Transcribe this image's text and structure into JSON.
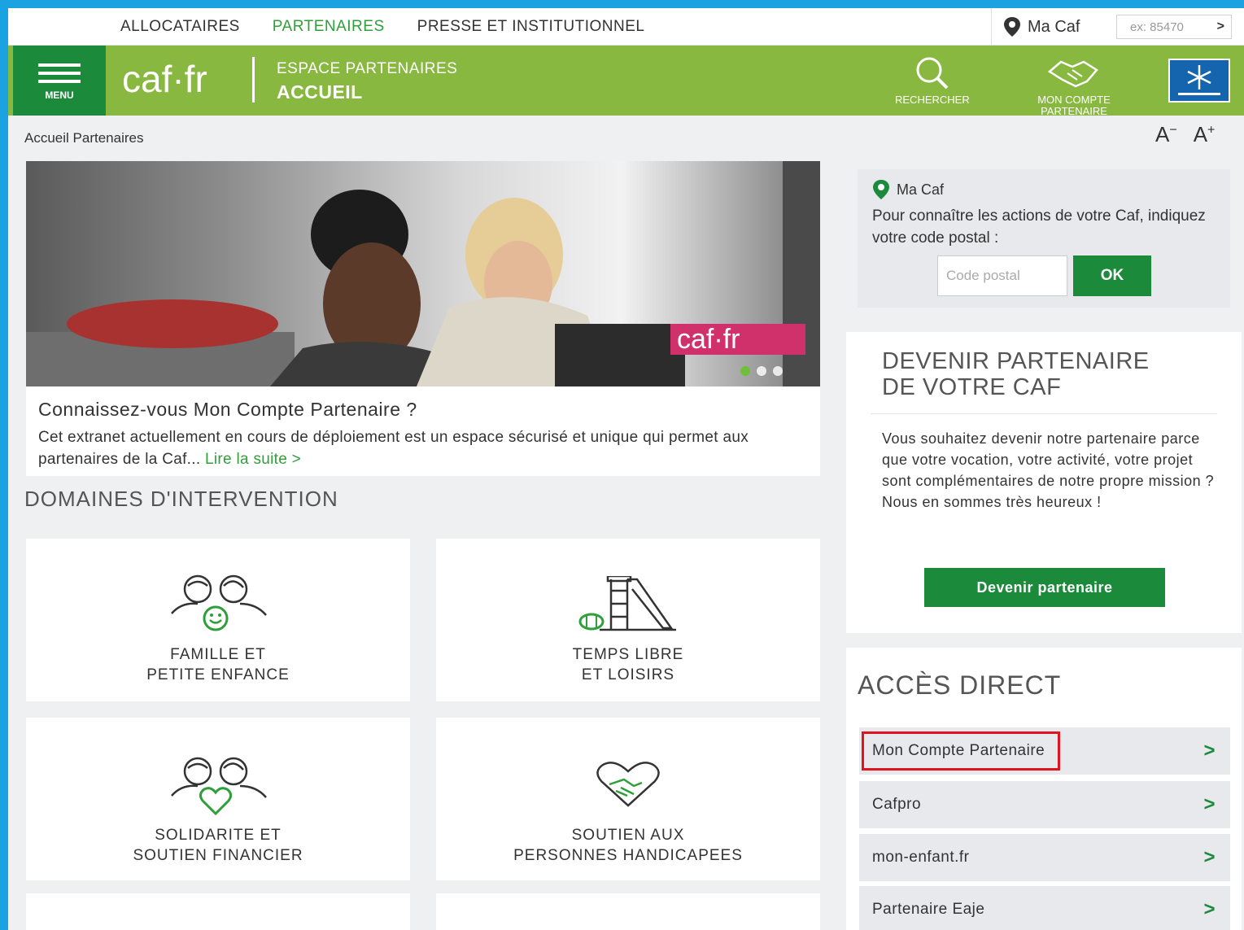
{
  "topnav": {
    "links": [
      "ALLOCATAIRES",
      "PARTENAIRES",
      "PRESSE ET INSTITUTIONNEL"
    ],
    "macaf_label": "Ma Caf",
    "postal_placeholder": "ex: 85470",
    "postal_arrow": ">"
  },
  "header": {
    "menu_label": "MENU",
    "logo": "caf·fr",
    "espace_line1": "ESPACE PARTENAIRES",
    "espace_line2": "ACCUEIL",
    "search_label": "RECHERCHER",
    "account_label_1": "MON COMPTE",
    "account_label_2": "PARTENAIRE"
  },
  "breadcrumb": "Accueil Partenaires",
  "fontsize": {
    "decrease": "A",
    "decrease_sup": "−",
    "increase": "A",
    "increase_sup": "+"
  },
  "carousel": {
    "badge": "caf·fr",
    "title": "Connaissez-vous Mon Compte Partenaire ?",
    "text": "Cet extranet actuellement en cours de déploiement est un espace sécurisé et unique qui permet aux partenaires de la Caf...",
    "link": "Lire la suite >",
    "slides": 3,
    "active_slide": 1
  },
  "domaines": {
    "title": "DOMAINES D'INTERVENTION",
    "tiles": [
      {
        "icon": "family-icon",
        "line1": "FAMILLE ET",
        "line2": "PETITE ENFANCE"
      },
      {
        "icon": "playground-icon",
        "line1": "TEMPS LIBRE",
        "line2": "ET LOISIRS"
      },
      {
        "icon": "solidarity-icon",
        "line1": "SOLIDARITE ET",
        "line2": "SOUTIEN FINANCIER"
      },
      {
        "icon": "handshake-heart-icon",
        "line1": "SOUTIEN AUX",
        "line2": "PERSONNES HANDICAPEES"
      }
    ]
  },
  "macaf_box": {
    "title": "Ma Caf",
    "description": "Pour connaître les actions de votre Caf, indiquez votre code postal :",
    "input_placeholder": "Code postal",
    "ok_label": "OK"
  },
  "devenir": {
    "title_line1": "DEVENIR PARTENAIRE",
    "title_line2": "DE VOTRE CAF",
    "text": "Vous souhaitez devenir notre partenaire parce que votre vocation, votre activité, votre projet sont complémentaires de notre propre mission ? Nous en sommes très heureux !",
    "button": "Devenir partenaire"
  },
  "acces": {
    "title": "ACCÈS DIRECT",
    "items": [
      {
        "label": "Mon Compte Partenaire",
        "highlighted": true
      },
      {
        "label": "Cafpro",
        "highlighted": false
      },
      {
        "label": "mon-enfant.fr",
        "highlighted": false
      },
      {
        "label": "Partenaire Eaje",
        "highlighted": false
      }
    ],
    "chevron": ">"
  },
  "colors": {
    "primary_green": "#1c8a3b",
    "header_green": "#88b83f",
    "accent_pink": "#d0316a",
    "highlight_red": "#e0141c"
  }
}
